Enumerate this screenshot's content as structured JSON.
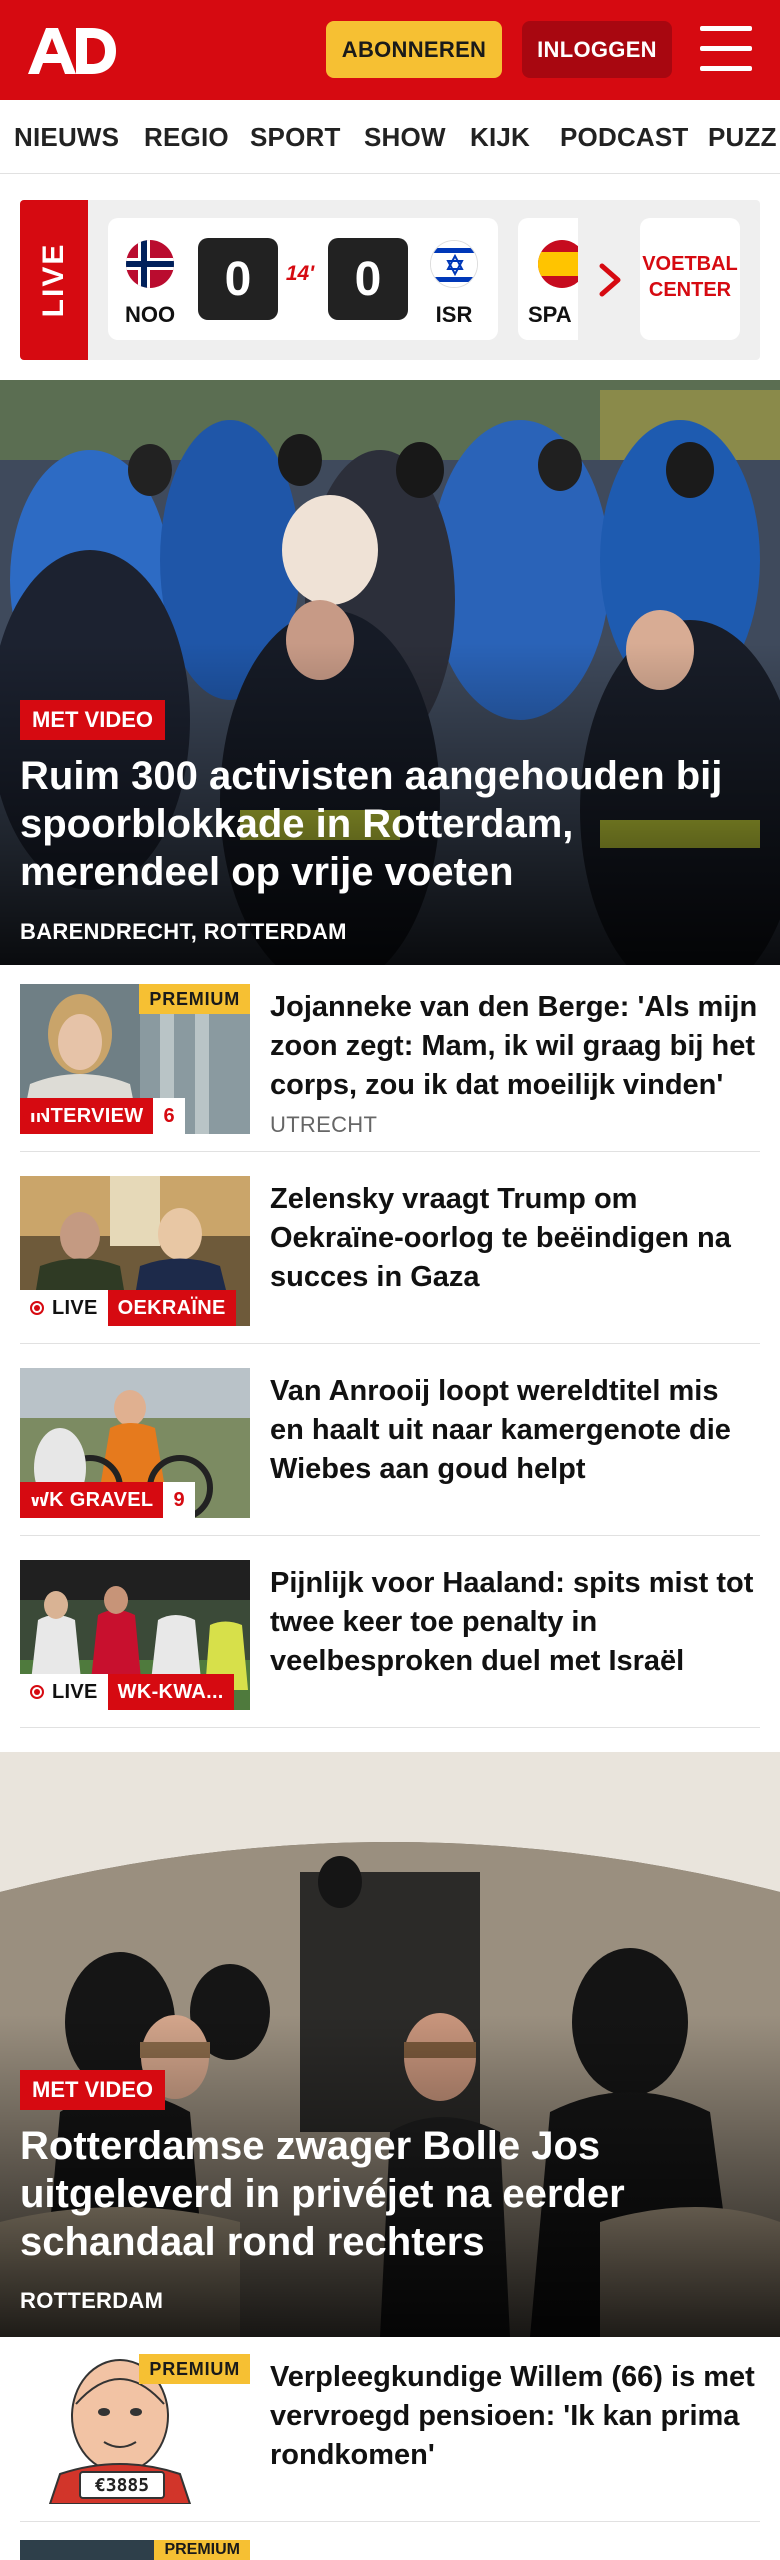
{
  "header": {
    "logo_text": "AD",
    "subscribe_label": "ABONNEREN",
    "login_label": "INLOGGEN",
    "brand_color": "#d60a11",
    "subscribe_color": "#f6c033"
  },
  "nav": {
    "items": [
      "NIEUWS",
      "REGIO",
      "SPORT",
      "SHOW",
      "KIJK",
      "PODCAST",
      "PUZZ"
    ]
  },
  "live_scores": {
    "live_label": "LIVE",
    "match": {
      "home_code": "NOO",
      "away_code": "ISR",
      "home_score": "0",
      "away_score": "0",
      "minute": "14'"
    },
    "next_match_code": "SPA",
    "center_label": "VOETBAL CENTER"
  },
  "hero1": {
    "badge": "MET VIDEO",
    "title": "Ruim 300 activisten aangehouden bij spoorblokkade in Rotterdam, merendeel op vrije voeten",
    "location": "BARENDRECHT, ROTTERDAM"
  },
  "articles": [
    {
      "premium": "PREMIUM",
      "tag": "INTERVIEW",
      "comments": "6",
      "title": "Jojanneke van den Berge: 'Als mijn zoon zegt: Mam, ik wil graag bij het corps, zou ik dat moeilijk vinden'",
      "location": "UTRECHT"
    },
    {
      "live_label": "LIVE",
      "tag": "OEKRAÏNE",
      "title": "Zelensky vraagt Trump om Oekraïne-oorlog te beëindigen na succes in Gaza"
    },
    {
      "tag": "WK GRAVEL",
      "comments": "9",
      "title": "Van Anrooij loopt wereldtitel mis en haalt uit naar kamergenote die Wiebes aan goud helpt"
    },
    {
      "live_label": "LIVE",
      "tag": "WK-KWA...",
      "title": "Pijnlijk voor Haaland: spits mist tot twee keer toe penalty in veelbesproken duel met Israël"
    }
  ],
  "hero2": {
    "badge": "MET VIDEO",
    "title": "Rotterdamse zwager Bolle Jos uitgeleverd in privéjet na eerder schandaal rond rechters",
    "location": "ROTTERDAM"
  },
  "article_bottom": {
    "premium": "PREMIUM",
    "title": "Verpleegkundige Willem (66) is met vervroegd pensioen: 'Ik kan prima rondkomen'",
    "plate_text": "€3885"
  },
  "article_partial": {
    "premium": "PREMIUM"
  }
}
